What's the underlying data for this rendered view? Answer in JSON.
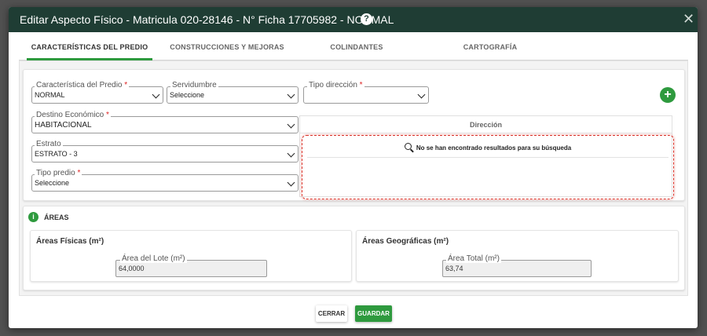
{
  "modal": {
    "title": "Editar Aspecto Físico - Matricula 020-28146 - N° Ficha 17705982 - NORMAL",
    "help_icon": "?",
    "close_icon": "✕"
  },
  "tabs": [
    {
      "label": "CARACTERÍSTICAS DEL PREDIO",
      "active": true
    },
    {
      "label": "CONSTRUCCIONES Y MEJORAS",
      "active": false
    },
    {
      "label": "COLINDANTES",
      "active": false
    },
    {
      "label": "CARTOGRAFÍA",
      "active": false
    }
  ],
  "form": {
    "caracteristica": {
      "label": "Característica del Predio",
      "value": "NORMAL"
    },
    "servidumbre": {
      "label": "Servidumbre",
      "value": "Seleccione"
    },
    "tipo_direccion": {
      "label": "Tipo dirección",
      "value": ""
    },
    "destino": {
      "label": "Destino Económico",
      "value": "HABITACIONAL"
    },
    "estrato": {
      "label": "Estrato",
      "value": "ESTRATO - 3"
    },
    "tipo_predio": {
      "label": "Tipo predio",
      "value": "Seleccione"
    },
    "required_mark": "*",
    "add_icon": "+"
  },
  "direccion_table": {
    "header": "Dirección",
    "empty_message": "No se han encontrado resultados para su búsqueda"
  },
  "areas": {
    "title": "ÁREAS",
    "info_icon": "i",
    "fisicas": {
      "title": "Áreas Físicas (m²)",
      "field_label": "Área del Lote (m²)",
      "value": "64,0000"
    },
    "geograficas": {
      "title": "Áreas Geográficas (m²)",
      "field_label": "Área Total (m²)",
      "value": "63,74"
    }
  },
  "footer": {
    "close_label": "CERRAR",
    "save_label": "GUARDAR"
  },
  "colors": {
    "header_bg": "#1f3d34",
    "accent_green": "#2e9a3e",
    "error_red": "#d9342b"
  }
}
